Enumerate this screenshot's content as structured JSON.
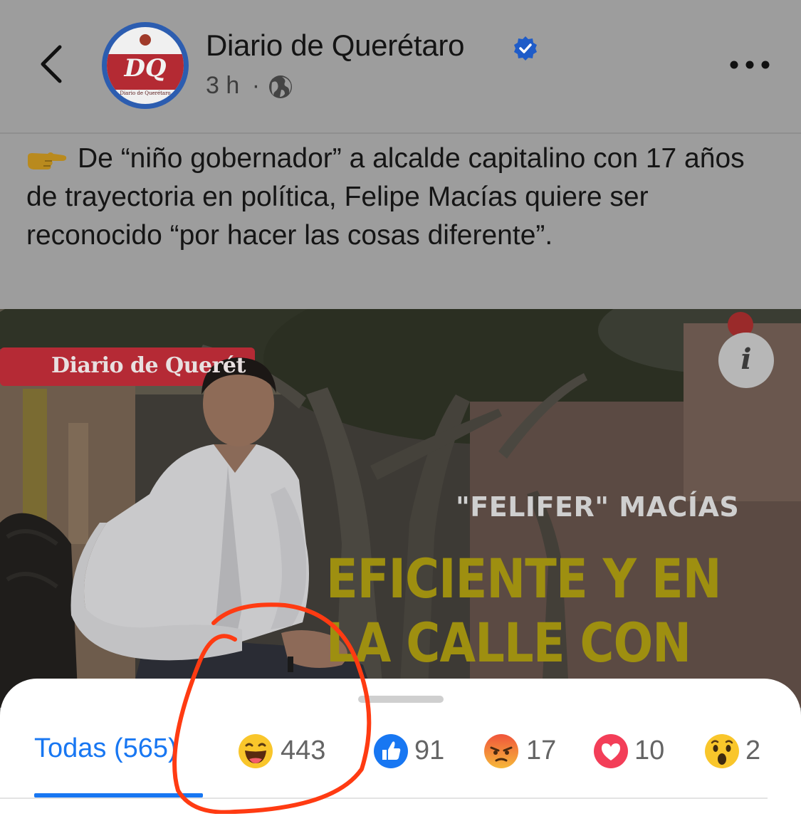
{
  "header": {
    "page_name": "Diario de Querétaro",
    "time_ago": "3 h",
    "separator": "·",
    "avatar_letters": "DQ",
    "avatar_caption": "Diario de Querétaro",
    "icons": [
      "back-chevron-icon",
      "verified-badge-icon",
      "globe-icon",
      "more-icon"
    ]
  },
  "post": {
    "caption": "De “niño gobernador” a alcalde capitalino con 17 años de trayectoria en política, Felipe Macías quiere ser reconocido “por hacer las cosas diferente”.",
    "image": {
      "banner": "Diario de Querét",
      "kicker": "\"FELIFER\" MACÍAS",
      "headline_line1": "EFICIENTE Y EN",
      "headline_line2": "LA CALLE CON",
      "info_label": "i"
    }
  },
  "reactions": {
    "tabs": [
      {
        "label": "Todas (565)",
        "icon": null
      },
      {
        "count": "443",
        "icon": "haha-icon"
      },
      {
        "count": "91",
        "icon": "like-icon"
      },
      {
        "count": "17",
        "icon": "angry-icon"
      },
      {
        "count": "10",
        "icon": "love-icon"
      },
      {
        "count": "2",
        "icon": "wow-icon"
      }
    ],
    "active_tab": 0
  },
  "colors": {
    "accent": "#1877f2",
    "annotation": "#ff3b12",
    "headline": "#9e8f10",
    "banner": "#b52a35"
  }
}
